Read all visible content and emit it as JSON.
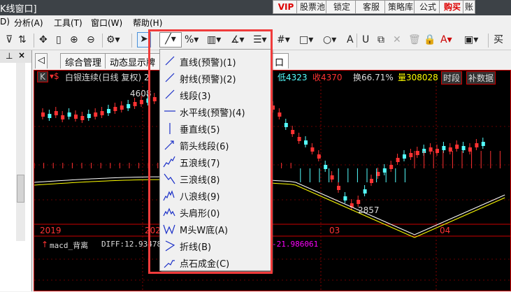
{
  "window": {
    "title": "K线窗口]"
  },
  "title_buttons": [
    "VIP",
    "股票池",
    "锁定",
    "客服",
    "策略库",
    "公式",
    "购买",
    "账"
  ],
  "menubar": [
    "D)",
    "分析(A)",
    "工具(T)",
    "窗口(W)",
    "帮助(H)"
  ],
  "tabs": [
    "综合管理",
    "动态显示牌",
    "口"
  ],
  "left_panel": {
    "pin": "⊥",
    "close": "×"
  },
  "chart_info": {
    "k": "K",
    "title": "白银连续(日线 复权) 2",
    "low": "低4323",
    "close": "收4370",
    "turnover": "换66.71%",
    "volume": "量308028",
    "btn_period": "时段",
    "btn_fill": "补数据"
  },
  "price_labels": {
    "high": "4608",
    "low": "2857"
  },
  "date_axis": [
    "2019",
    "202",
    "03",
    "04"
  ],
  "macd": {
    "name": "macd_背离",
    "diff": "DIFF:12.93478",
    "dea": "-21.986061"
  },
  "draw_menu": {
    "items": [
      "直线(预警)(1)",
      "射线(预警)(2)",
      "线段(3)",
      "水平线(预警)(4)",
      "垂直线(5)",
      "箭头线段(6)",
      "五浪线(7)",
      "三浪线(8)",
      "八浪线(9)",
      "头肩形(0)",
      "M头W底(A)",
      "折线(B)",
      "点石成金(C)"
    ]
  },
  "colors": {
    "up": "#ff3232",
    "down": "#54ffff",
    "highlight": "#f03c3c"
  }
}
